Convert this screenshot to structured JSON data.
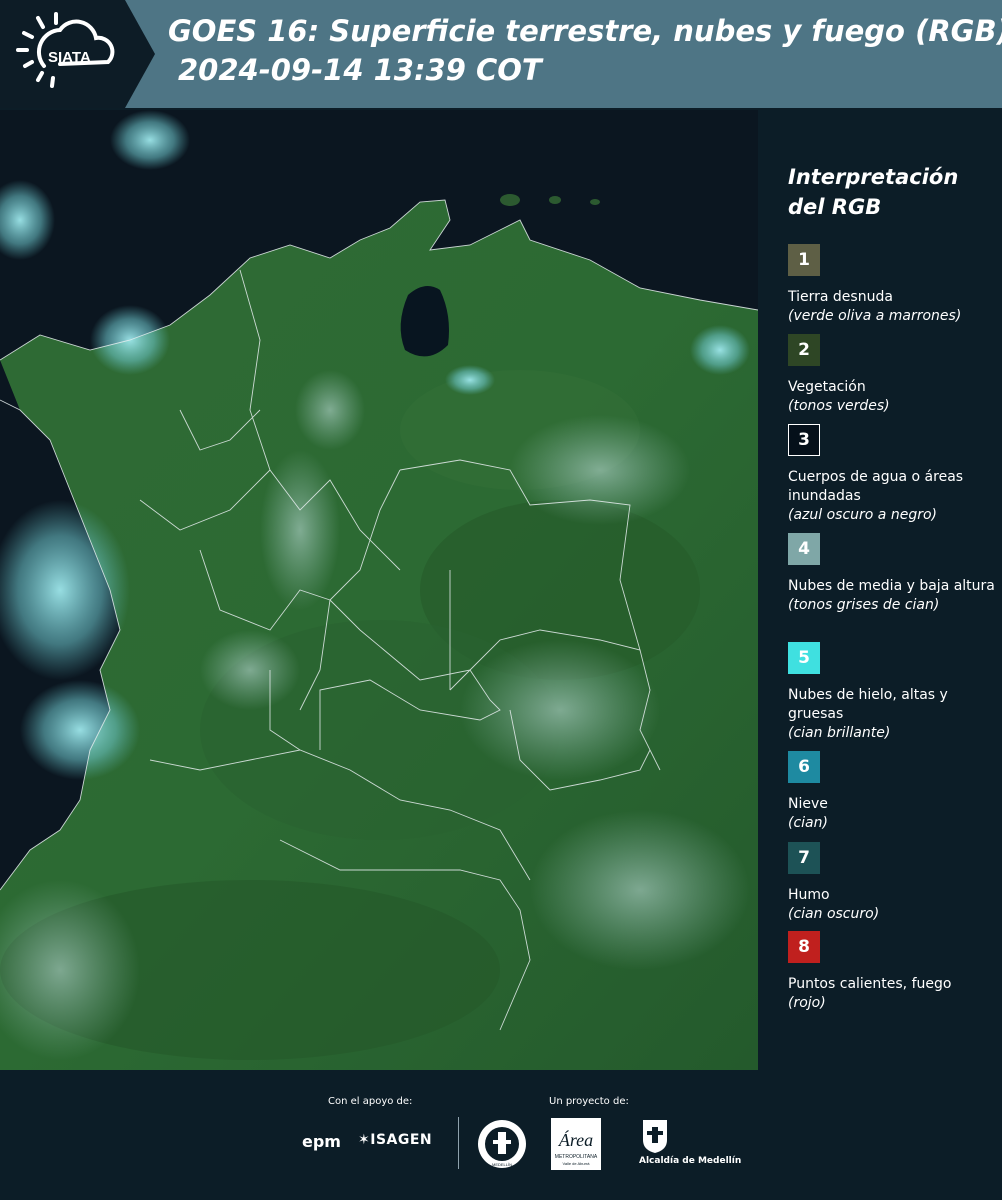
{
  "header": {
    "title_line1": "GOES 16: Superficie terrestre, nubes y fuego (RGB)",
    "title_line2": "2024-09-14 13:39 COT",
    "logo_text": "SIATA",
    "background_color": "#4e7585"
  },
  "legend": {
    "heading": "Interpretación del RGB",
    "items": [
      {
        "number": "1",
        "label": "Tierra desnuda",
        "hint": "(verde oliva a marrones)",
        "color": "#5e5f45"
      },
      {
        "number": "2",
        "label": "Vegetación",
        "hint": "(tonos verdes)",
        "color": "#2e4625"
      },
      {
        "number": "3",
        "label": "Cuerpos de agua o áreas inundadas",
        "hint": "(azul oscuro a negro)",
        "color": "#05101a"
      },
      {
        "number": "4",
        "label": "Nubes de media y baja altura",
        "hint": "(tonos grises de cian)",
        "color": "#7fa7a7"
      },
      {
        "number": "5",
        "label": "Nubes de hielo, altas y gruesas",
        "hint": "(cian brillante)",
        "color": "#3fe0e0"
      },
      {
        "number": "6",
        "label": "Nieve",
        "hint": "(cian)",
        "color": "#1e8aa1"
      },
      {
        "number": "7",
        "label": "Humo",
        "hint": "(cian oscuro)",
        "color": "#1d5256"
      },
      {
        "number": "8",
        "label": "Puntos calientes, fuego",
        "hint": "(rojo)",
        "color": "#c0201e"
      }
    ]
  },
  "footer": {
    "support_label": "Con el apoyo de:",
    "project_label": "Un proyecto de:",
    "sponsors": [
      "epm",
      "ISAGEN"
    ],
    "partners": [
      "Área Metropolitana Valle de Aburrá",
      "Alcaldía de Medellín"
    ]
  },
  "partner_logo_text": {
    "area_name": "Área",
    "area_sub": "METROPOLITANA",
    "area_region": "Valle de Aburrá",
    "alcaldia": "Alcaldía de Medellín",
    "epm_mark": "epm",
    "isagen_mark": "ISAGEN",
    "seal_text": "MEDELLÍN"
  }
}
